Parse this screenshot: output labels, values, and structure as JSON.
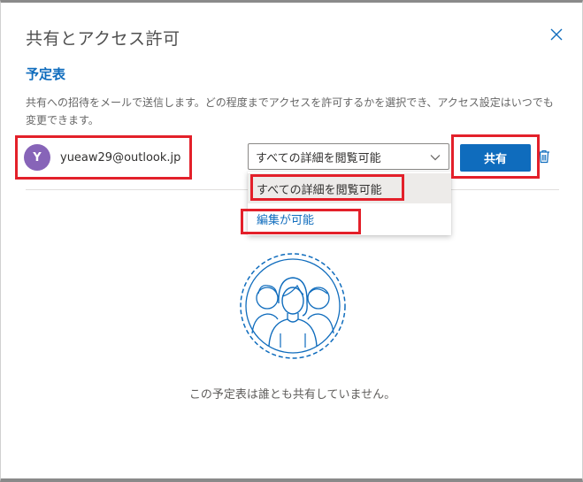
{
  "dialog": {
    "title": "共有とアクセス許可",
    "close_icon": "close-icon"
  },
  "section": {
    "title": "予定表",
    "description": "共有への招待をメールで送信します。どの程度までアクセスを許可するかを選択でき、アクセス設定はいつでも変更できます。"
  },
  "invitee": {
    "avatar_initial": "Y",
    "email": "yueaw29@outlook.jp",
    "avatar_color": "#8764b8"
  },
  "permission": {
    "selected": "すべての詳細を閲覧可能",
    "options": [
      "すべての詳細を閲覧可能",
      "編集が可能"
    ]
  },
  "actions": {
    "share_label": "共有",
    "delete_icon": "trash-icon"
  },
  "empty_state": {
    "message": "この予定表は誰とも共有していません。",
    "icon": "people-group-icon"
  },
  "colors": {
    "accent": "#0f6cbd",
    "highlight": "#e3202a",
    "avatar": "#8764b8"
  }
}
